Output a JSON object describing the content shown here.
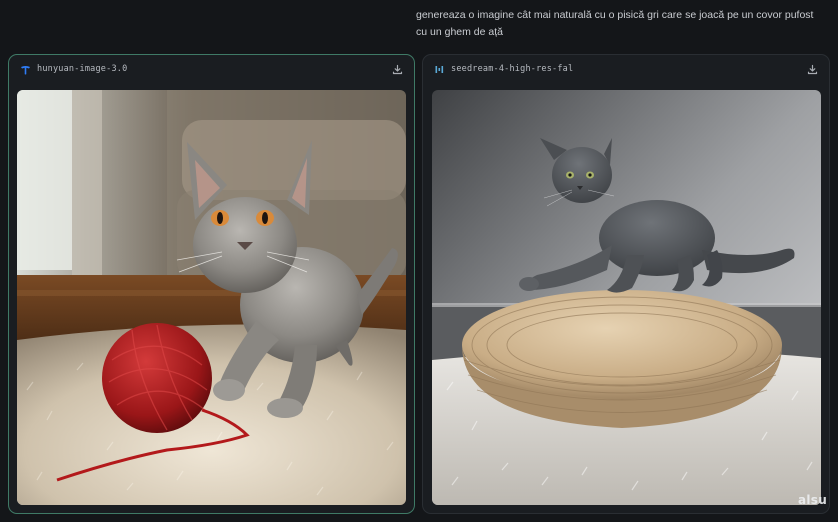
{
  "prompt": {
    "text": "genereaza o imagine cât mai naturală cu o pisică gri care se joacă pe un covor pufost cu un ghem de ață"
  },
  "results": [
    {
      "model": "hunyuan-image-3.0",
      "icon": "hunyuan-logo-icon",
      "selected": true,
      "image_alt": "grey kitten playing with red yarn ball on fluffy rug",
      "download_icon": "download-icon"
    },
    {
      "model": "seedream-4-high-res-fal",
      "icon": "seedream-logo-icon",
      "selected": false,
      "image_alt": "grey kitten on a woven rope pouf over a fluffy rug",
      "download_icon": "download-icon"
    }
  ],
  "watermark": "alsu",
  "colors": {
    "background": "#141619",
    "card": "#1a1d21",
    "selected_border": "#3f7a66",
    "hunyuan_icon": "#2f7cf6",
    "seedream_icon": "#5aa9d6"
  }
}
